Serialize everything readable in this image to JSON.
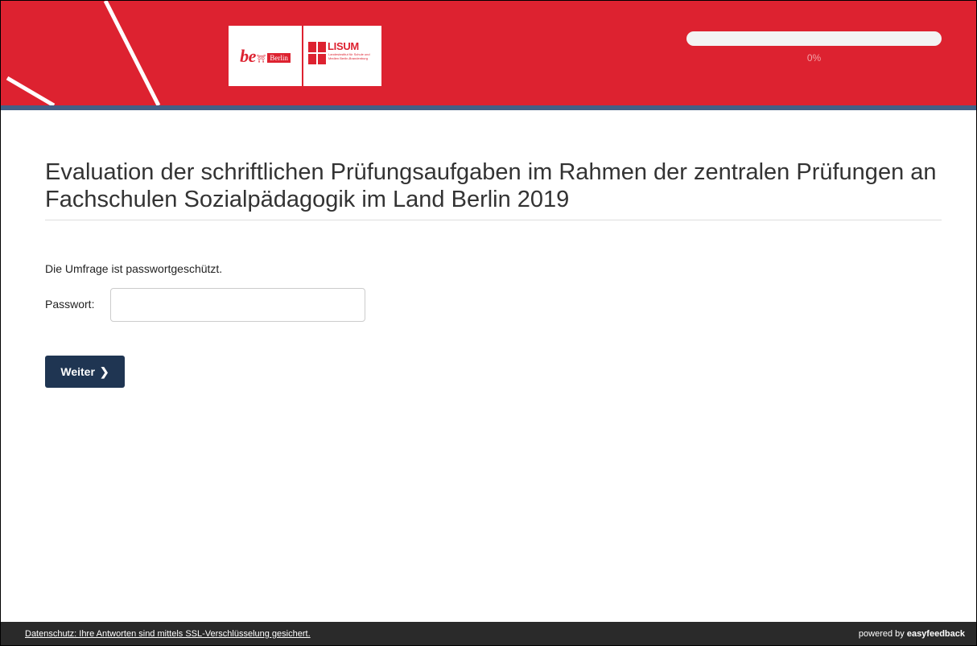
{
  "header": {
    "logo_left": {
      "brand": "be",
      "tag": "Berlin"
    },
    "logo_right": {
      "brand": "LISUM",
      "subtitle": "Landesinstitut für Schule und Medien Berlin-Brandenburg"
    },
    "progress": {
      "value_percent": 0,
      "label": "0%"
    }
  },
  "colors": {
    "header_red": "#dd2230",
    "stripe_blue": "#445f86",
    "button_navy": "#1f3552",
    "footer_dark": "#2a2a2a"
  },
  "main": {
    "title": "Evaluation der schriftlichen Prüfungsaufgaben im Rahmen der zentralen Prüfungen an Fachschulen Sozialpädagogik im Land Berlin 2019",
    "notice": "Die Umfrage ist passwortgeschützt.",
    "password_label": "Passwort:",
    "password_value": "",
    "next_button": {
      "label": "Weiter",
      "icon": "chevron-right-icon"
    }
  },
  "footer": {
    "privacy_link": "Datenschutz: Ihre Antworten sind mittels SSL-Verschlüsselung gesichert.",
    "powered_prefix": "powered by ",
    "powered_brand": "easyfeedback"
  }
}
